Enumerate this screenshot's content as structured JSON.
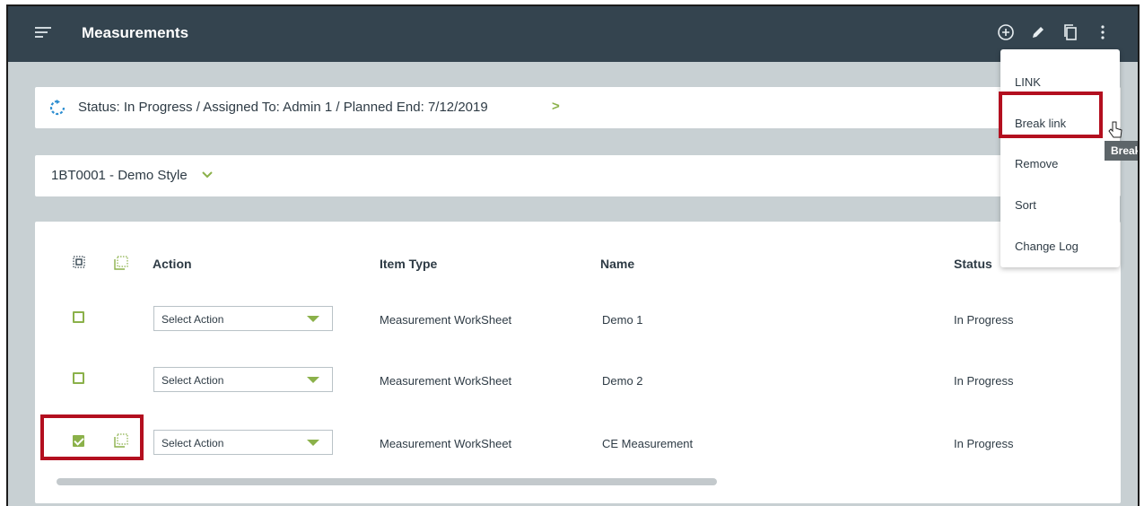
{
  "header": {
    "title": "Measurements"
  },
  "status_bar": {
    "text": "Status: In Progress / Assigned To: Admin 1 / Planned End: 7/12/2019",
    "chevron": ">"
  },
  "style_selector": {
    "text": "1BT0001 - Demo Style"
  },
  "table": {
    "columns": {
      "action": "Action",
      "item_type": "Item Type",
      "name": "Name",
      "status": "Status"
    },
    "rows": [
      {
        "checked": false,
        "action": "Select Action",
        "item_type": "Measurement WorkSheet",
        "name": "Demo 1",
        "status": "In Progress"
      },
      {
        "checked": false,
        "action": "Select Action",
        "item_type": "Measurement WorkSheet",
        "name": "Demo 2",
        "status": "In Progress"
      },
      {
        "checked": true,
        "action": "Select Action",
        "item_type": "Measurement WorkSheet",
        "name": "CE Measurement",
        "status": "In Progress"
      }
    ]
  },
  "menu": {
    "items": [
      "LINK",
      "Break link",
      "Remove",
      "Sort",
      "Change Log"
    ]
  },
  "tooltip": {
    "text": "Break"
  },
  "colors": {
    "header_bg": "#34444f",
    "accent_green": "#8bb14a",
    "highlight_red": "#b30f1f",
    "canvas_bg": "#c8d0d3"
  },
  "icons": [
    "menu-icon",
    "add-circle-icon",
    "edit-pencil-icon",
    "copy-icon",
    "more-vertical-icon",
    "refresh-icon",
    "chevron-right-icon",
    "chevron-down-icon",
    "select-all-icon",
    "copy-rows-icon",
    "hand-cursor-icon"
  ]
}
